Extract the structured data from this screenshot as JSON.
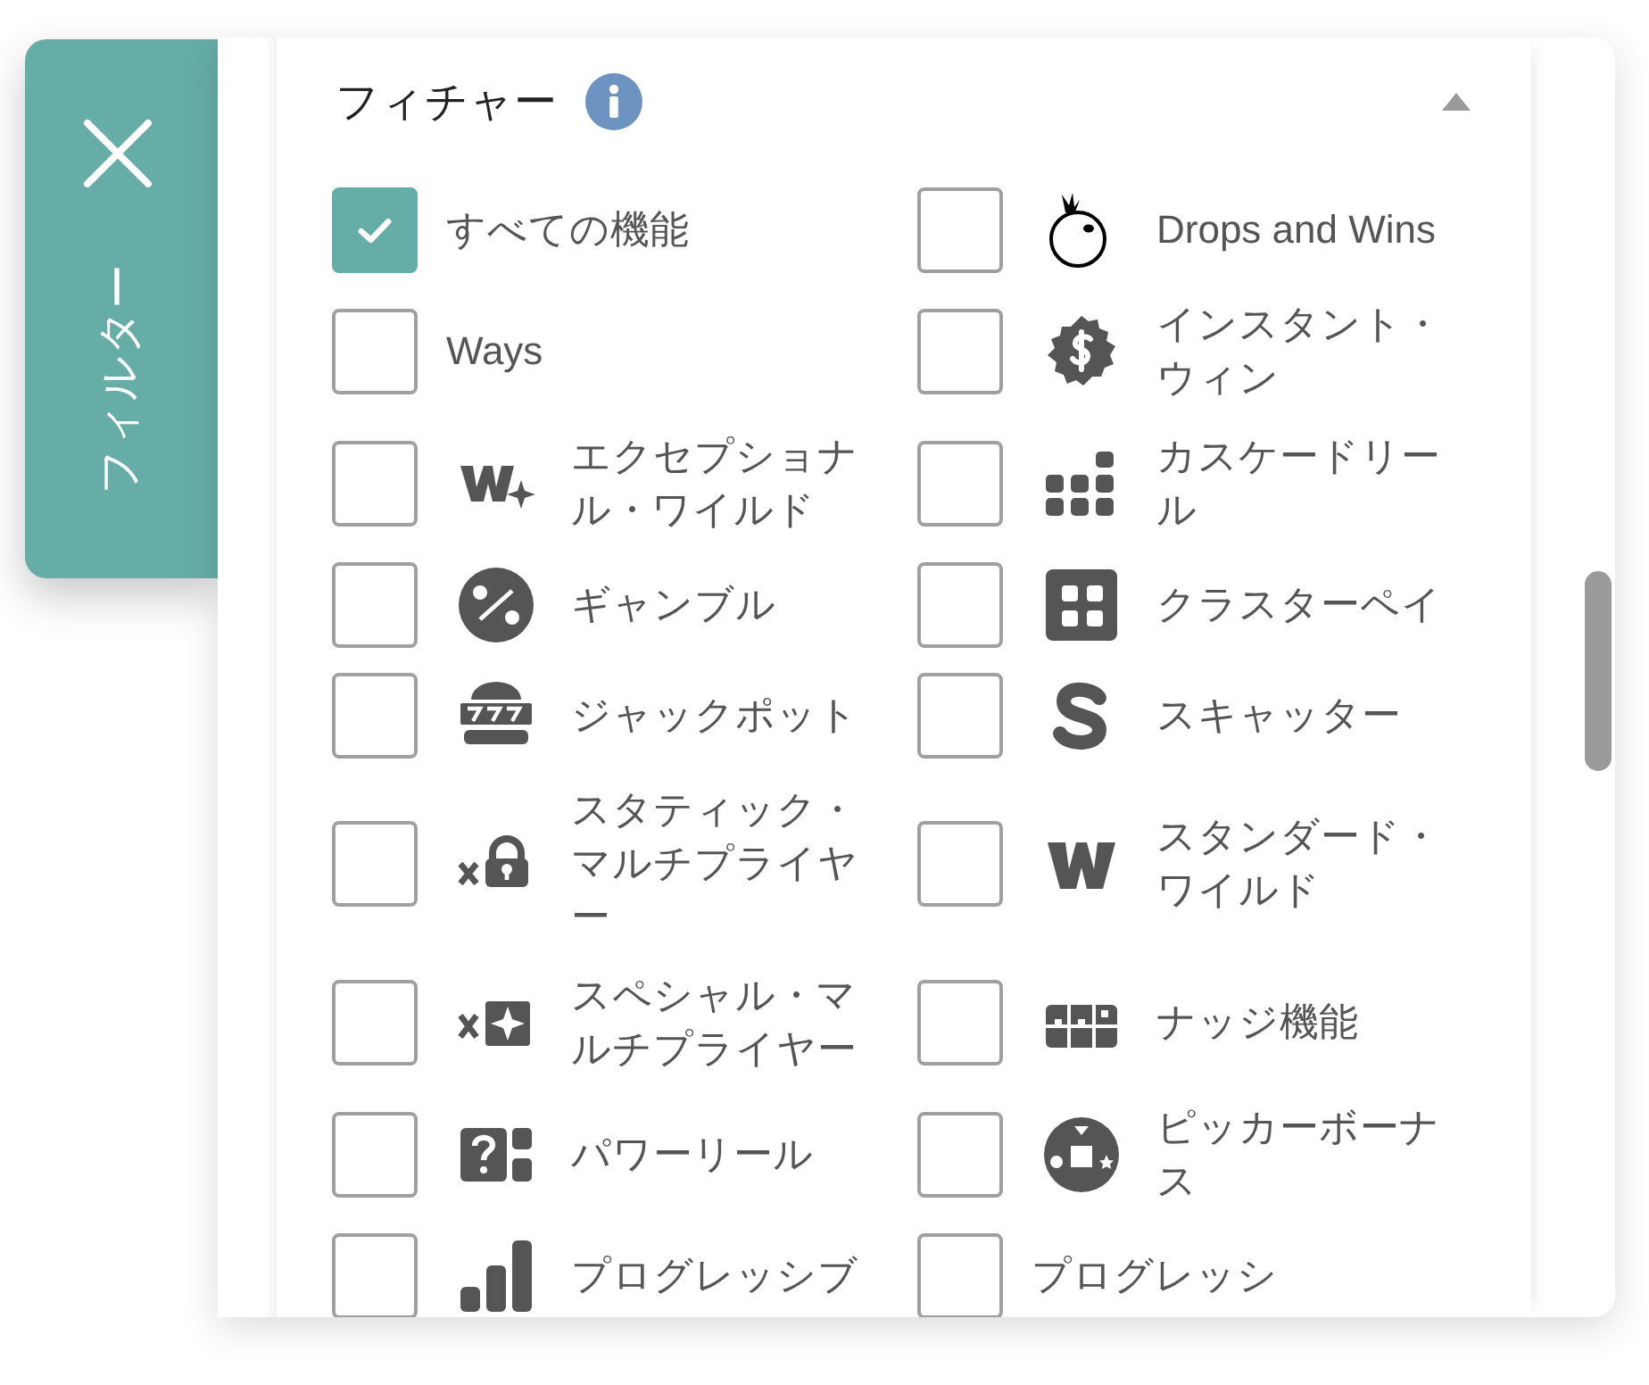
{
  "side_tab": {
    "label": "フィルター"
  },
  "section": {
    "title": "フィチャー",
    "expanded": true
  },
  "features": [
    {
      "label": "すべての機能",
      "checked": true
    },
    {
      "label": "Drops and Wins",
      "checked": false
    },
    {
      "label": "Ways",
      "checked": false
    },
    {
      "label": "インスタント・ウィン",
      "checked": false
    },
    {
      "label": "エクセプショナル・ワイルド",
      "checked": false
    },
    {
      "label": "カスケードリール",
      "checked": false
    },
    {
      "label": "ギャンブル",
      "checked": false
    },
    {
      "label": "クラスターペイ",
      "checked": false
    },
    {
      "label": "ジャックポット",
      "checked": false
    },
    {
      "label": "スキャッター",
      "checked": false
    },
    {
      "label": "スタティック・マルチプライヤー",
      "checked": false
    },
    {
      "label": "スタンダード・ワイルド",
      "checked": false
    },
    {
      "label": "スペシャル・マルチプライヤー",
      "checked": false
    },
    {
      "label": "ナッジ機能",
      "checked": false
    },
    {
      "label": "パワーリール",
      "checked": false
    },
    {
      "label": "ピッカーボーナス",
      "checked": false
    },
    {
      "label": "プログレッシブ",
      "checked": false
    },
    {
      "label": "プログレッシ",
      "checked": false
    }
  ]
}
